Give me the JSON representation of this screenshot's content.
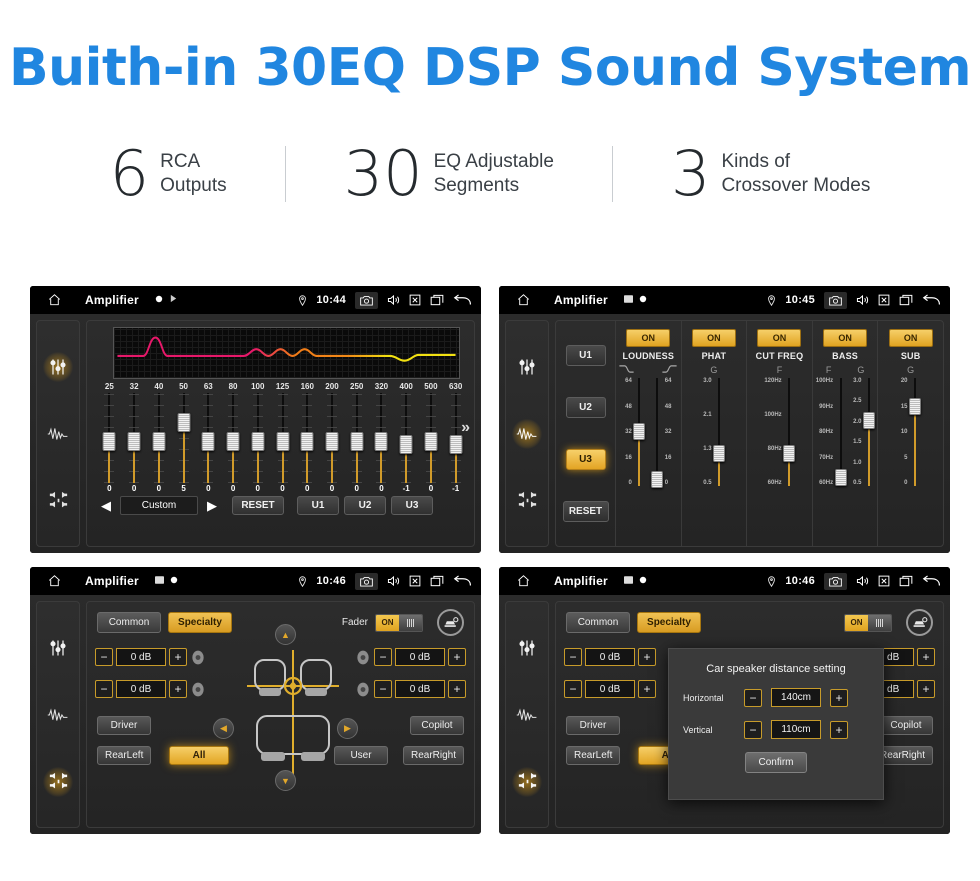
{
  "header": {
    "title": "Buith-in 30EQ DSP Sound System",
    "accent_color": "#2086e0"
  },
  "stats": [
    {
      "number": "6",
      "line1": "RCA",
      "line2": "Outputs"
    },
    {
      "number": "30",
      "line1": "EQ Adjustable",
      "line2": "Segments"
    },
    {
      "number": "3",
      "line1": "Kinds of",
      "line2": "Crossover Modes"
    }
  ],
  "panels": [
    {
      "statusbar": {
        "title": "Amplifier",
        "time": "10:44",
        "icons": [
          "home-icon",
          "record-dot-icon",
          "play-icon",
          "location-pin-icon",
          "camera-icon",
          "volume-icon",
          "close-box-icon",
          "recent-apps-icon",
          "back-arrow-icon"
        ]
      },
      "sidebar": {
        "items": [
          "equalizer-icon",
          "waveform-icon",
          "speaker-balance-icon"
        ],
        "active_index": 0
      },
      "eq": {
        "frequencies": [
          "25",
          "32",
          "40",
          "50",
          "63",
          "80",
          "100",
          "125",
          "160",
          "200",
          "250",
          "320",
          "400",
          "500",
          "630"
        ],
        "values": [
          "0",
          "0",
          "0",
          "5",
          "0",
          "0",
          "0",
          "0",
          "0",
          "0",
          "0",
          "0",
          "-1",
          "0",
          "-1"
        ],
        "numeric_values": [
          0,
          0,
          0,
          5,
          0,
          0,
          0,
          0,
          0,
          0,
          0,
          0,
          -1,
          0,
          -1
        ],
        "curve_colors": [
          "#e8186a",
          "#f07a18",
          "#f2e112"
        ],
        "preset_label": "Custom",
        "reset_label": "RESET",
        "user_presets": [
          "U1",
          "U2",
          "U3"
        ],
        "more_icon": "chevron-double-right-icon"
      }
    },
    {
      "statusbar": {
        "title": "Amplifier",
        "time": "10:45"
      },
      "sidebar": {
        "active_index": 1
      },
      "presets": {
        "buttons": [
          "U1",
          "U2",
          "U3"
        ],
        "active": "U3",
        "reset_label": "RESET"
      },
      "sections": [
        {
          "name": "LOUDNESS",
          "state": "ON",
          "sliders": [
            {
              "param": "curve-low-icon",
              "scale": [
                "64",
                "48",
                "32",
                "16",
                "0"
              ],
              "value_pct": 50
            },
            {
              "param": "curve-high-icon",
              "scale": [
                "64",
                "48",
                "32",
                "16",
                "0"
              ],
              "value_pct": 6
            }
          ]
        },
        {
          "name": "PHAT",
          "state": "ON",
          "sliders": [
            {
              "param": "G",
              "scale": [
                "3.0",
                "2.1",
                "1.3",
                "0.5"
              ],
              "value_pct": 30
            }
          ]
        },
        {
          "name": "CUT FREQ",
          "state": "ON",
          "sliders": [
            {
              "param": "F",
              "scale": [
                "120Hz",
                "100Hz",
                "80Hz",
                "60Hz"
              ],
              "value_pct": 30
            }
          ]
        },
        {
          "name": "BASS",
          "state": "ON",
          "sliders": [
            {
              "param": "F",
              "scale": [
                "100Hz",
                "90Hz",
                "80Hz",
                "70Hz",
                "60Hz"
              ],
              "value_pct": 7
            },
            {
              "param": "G",
              "scale": [
                "3.0",
                "2.5",
                "2.0",
                "1.5",
                "1.0",
                "0.5"
              ],
              "value_pct": 60
            }
          ]
        },
        {
          "name": "SUB",
          "state": "ON",
          "sliders": [
            {
              "param": "G",
              "scale": [
                "20",
                "15",
                "10",
                "5",
                "0"
              ],
              "value_pct": 73
            }
          ]
        }
      ]
    },
    {
      "statusbar": {
        "title": "Amplifier",
        "time": "10:46"
      },
      "sidebar": {
        "active_index": 2
      },
      "fader": {
        "tabs": [
          "Common",
          "Specialty"
        ],
        "active_tab": "Specialty",
        "fader_label": "Fader",
        "toggle_state": "ON",
        "gear_icon": "car-settings-icon",
        "db_controls": [
          {
            "position": "front-left",
            "value": "0 dB",
            "minus": "−",
            "plus": "+"
          },
          {
            "position": "rear-left",
            "value": "0 dB",
            "minus": "−",
            "plus": "+"
          },
          {
            "position": "front-right",
            "value": "0 dB",
            "minus": "−",
            "plus": "+"
          },
          {
            "position": "rear-right",
            "value": "0 dB",
            "minus": "−",
            "plus": "+"
          }
        ],
        "seat_buttons": [
          {
            "label": "Driver",
            "selected": false
          },
          {
            "label": "Copilot",
            "selected": false
          },
          {
            "label": "RearLeft",
            "selected": false
          },
          {
            "label": "All",
            "selected": true
          },
          {
            "label": "User",
            "selected": false
          },
          {
            "label": "RearRight",
            "selected": false
          }
        ],
        "nav_icons": [
          "arrow-up-icon",
          "arrow-left-icon",
          "arrow-right-icon",
          "arrow-down-icon"
        ]
      }
    },
    {
      "statusbar": {
        "title": "Amplifier",
        "time": "10:46"
      },
      "sidebar": {
        "active_index": 2
      },
      "dialog": {
        "title": "Car speaker distance setting",
        "rows": [
          {
            "label": "Horizontal",
            "value": "140cm",
            "minus": "−",
            "plus": "+"
          },
          {
            "label": "Vertical",
            "value": "110cm",
            "minus": "−",
            "plus": "+"
          }
        ],
        "confirm_label": "Confirm"
      }
    }
  ]
}
